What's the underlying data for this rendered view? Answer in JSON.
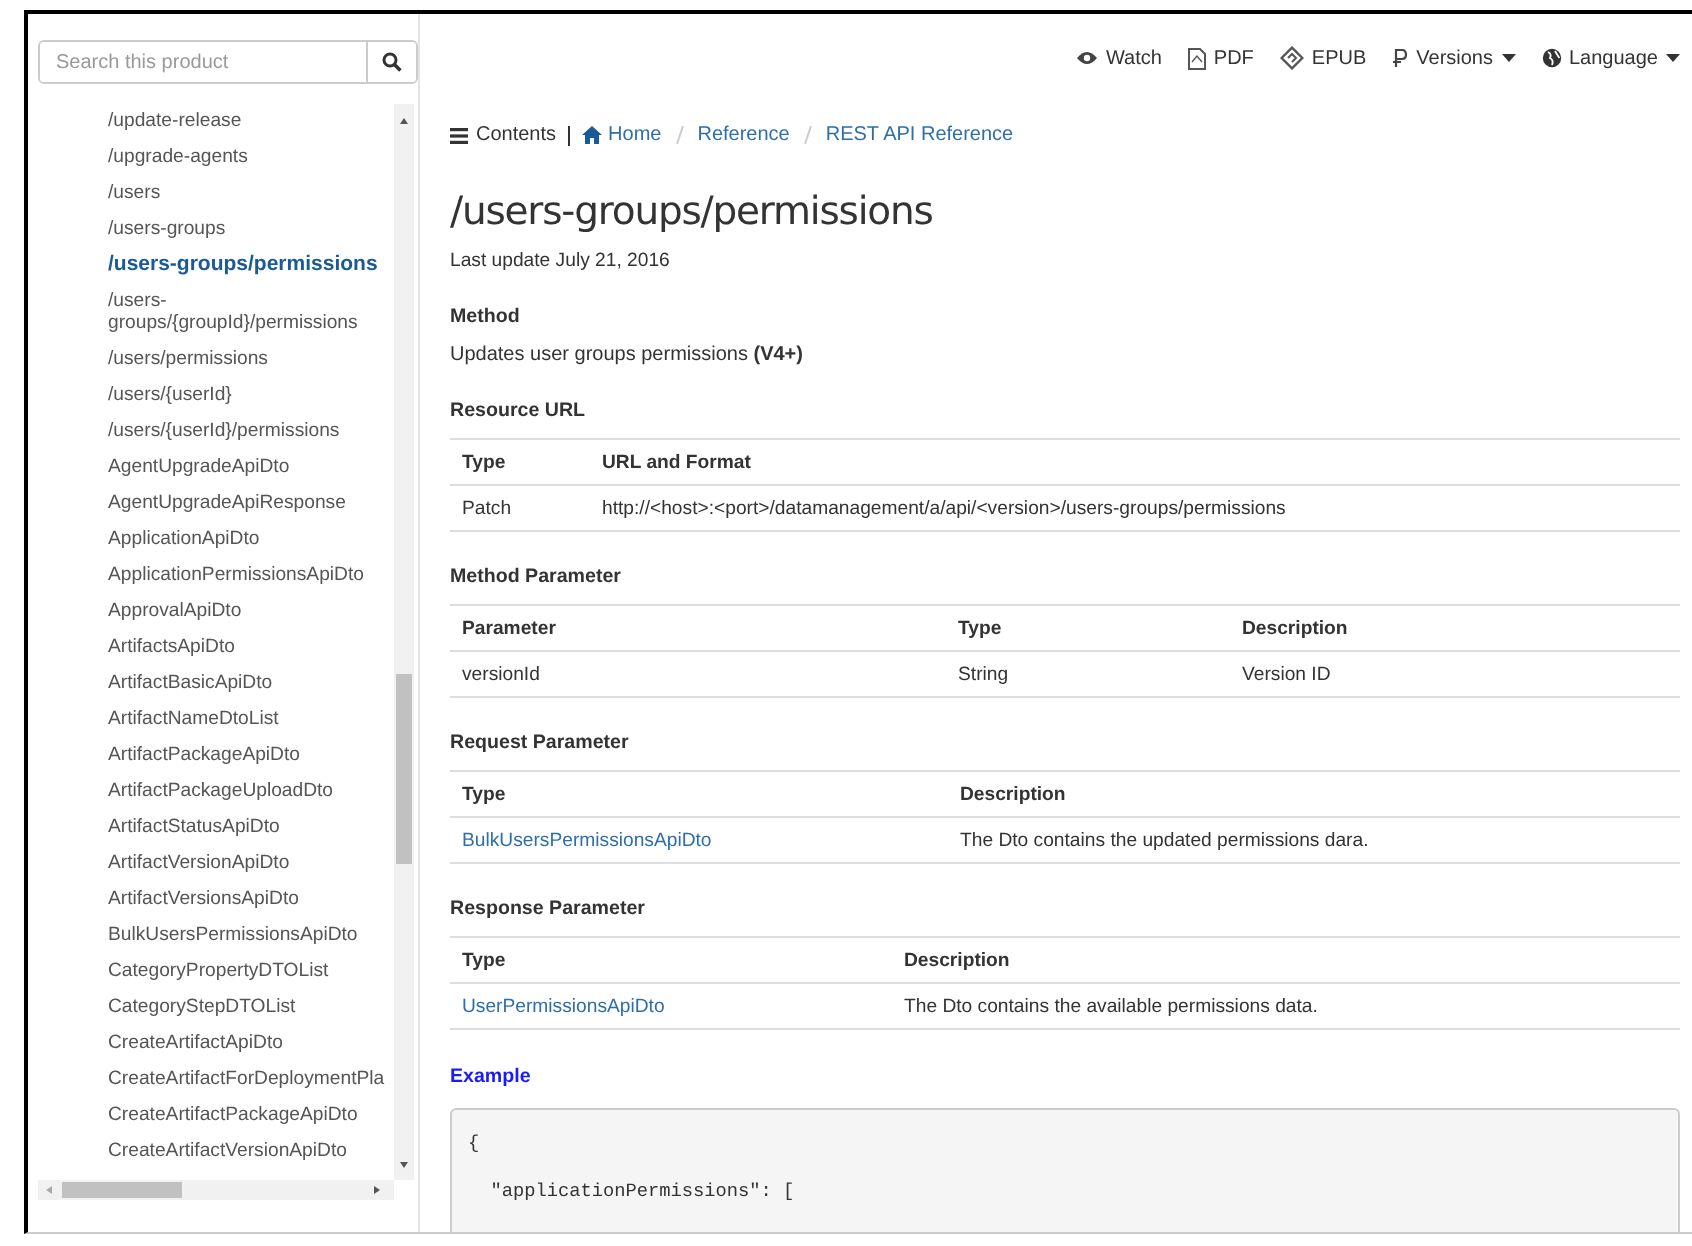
{
  "search": {
    "placeholder": "Search this product"
  },
  "sidebar": {
    "items": [
      {
        "label": "/update-release",
        "selected": false
      },
      {
        "label": "/upgrade-agents",
        "selected": false
      },
      {
        "label": "/users",
        "selected": false
      },
      {
        "label": "/users-groups",
        "selected": false
      },
      {
        "label": "/users-groups/permissions",
        "selected": true
      },
      {
        "label": "/users-groups/{groupId}/permissions",
        "selected": false
      },
      {
        "label": "/users/permissions",
        "selected": false
      },
      {
        "label": "/users/{userId}",
        "selected": false
      },
      {
        "label": "/users/{userId}/permissions",
        "selected": false
      },
      {
        "label": "AgentUpgradeApiDto",
        "selected": false
      },
      {
        "label": "AgentUpgradeApiResponse",
        "selected": false
      },
      {
        "label": "ApplicationApiDto",
        "selected": false
      },
      {
        "label": "ApplicationPermissionsApiDto",
        "selected": false
      },
      {
        "label": "ApprovalApiDto",
        "selected": false
      },
      {
        "label": "ArtifactsApiDto",
        "selected": false
      },
      {
        "label": "ArtifactBasicApiDto",
        "selected": false
      },
      {
        "label": "ArtifactNameDtoList",
        "selected": false
      },
      {
        "label": "ArtifactPackageApiDto",
        "selected": false
      },
      {
        "label": "ArtifactPackageUploadDto",
        "selected": false
      },
      {
        "label": "ArtifactStatusApiDto",
        "selected": false
      },
      {
        "label": "ArtifactVersionApiDto",
        "selected": false
      },
      {
        "label": "ArtifactVersionsApiDto",
        "selected": false
      },
      {
        "label": "BulkUsersPermissionsApiDto",
        "selected": false
      },
      {
        "label": "CategoryPropertyDTOList",
        "selected": false
      },
      {
        "label": "CategoryStepDTOList",
        "selected": false
      },
      {
        "label": "CreateArtifactApiDto",
        "selected": false
      },
      {
        "label": "CreateArtifactForDeploymentPla",
        "selected": false
      },
      {
        "label": "CreateArtifactPackageApiDto",
        "selected": false
      },
      {
        "label": "CreateArtifactVersionApiDto",
        "selected": false
      }
    ]
  },
  "toolbar": [
    {
      "label": "Watch",
      "kind": "watch",
      "dropdown": false
    },
    {
      "label": "PDF",
      "kind": "pdf",
      "dropdown": false
    },
    {
      "label": "EPUB",
      "kind": "epub",
      "dropdown": false
    },
    {
      "label": "Versions",
      "kind": "versions",
      "dropdown": true
    },
    {
      "label": "Language",
      "kind": "language",
      "dropdown": true
    }
  ],
  "breadcrumb": {
    "contents": "Contents",
    "items": [
      "Home",
      "Reference",
      "REST API Reference"
    ]
  },
  "title": "/users-groups/permissions",
  "last_update": "Last update July 21, 2016",
  "sections": [
    {
      "kind": "text",
      "heading": "Method",
      "text": "Updates user groups permissions **(V4+)**"
    },
    {
      "kind": "table",
      "heading": "Resource URL",
      "columns": [
        "Type",
        "URL and Format"
      ],
      "rows": [
        [
          {
            "text": "Patch",
            "link": false
          },
          {
            "text": "http://<host>:<port>/datamanagement/a/api/<version>/users-groups/permissions",
            "link": false
          }
        ]
      ]
    },
    {
      "kind": "table",
      "heading": "Method Parameter",
      "columns": [
        "Parameter",
        "Type",
        "Description"
      ],
      "rows": [
        [
          {
            "text": "versionId",
            "link": false
          },
          {
            "text": "String",
            "link": false
          },
          {
            "text": "Version ID",
            "link": false
          }
        ]
      ]
    },
    {
      "kind": "table",
      "heading": "Request Parameter",
      "columns": [
        "Type",
        "Description"
      ],
      "rows": [
        [
          {
            "text": "BulkUsersPermissionsApiDto",
            "link": true
          },
          {
            "text": "The Dto contains the updated permissions dara.",
            "link": false
          }
        ]
      ]
    },
    {
      "kind": "table",
      "heading": "Response Parameter",
      "columns": [
        "Type",
        "Description"
      ],
      "rows": [
        [
          {
            "text": "UserPermissionsApiDto",
            "link": true
          },
          {
            "text": "The Dto contains the available permissions data.",
            "link": false
          }
        ]
      ]
    }
  ],
  "example": {
    "heading": "Example",
    "code": "{\n\n  \"applicationPermissions\": ["
  }
}
